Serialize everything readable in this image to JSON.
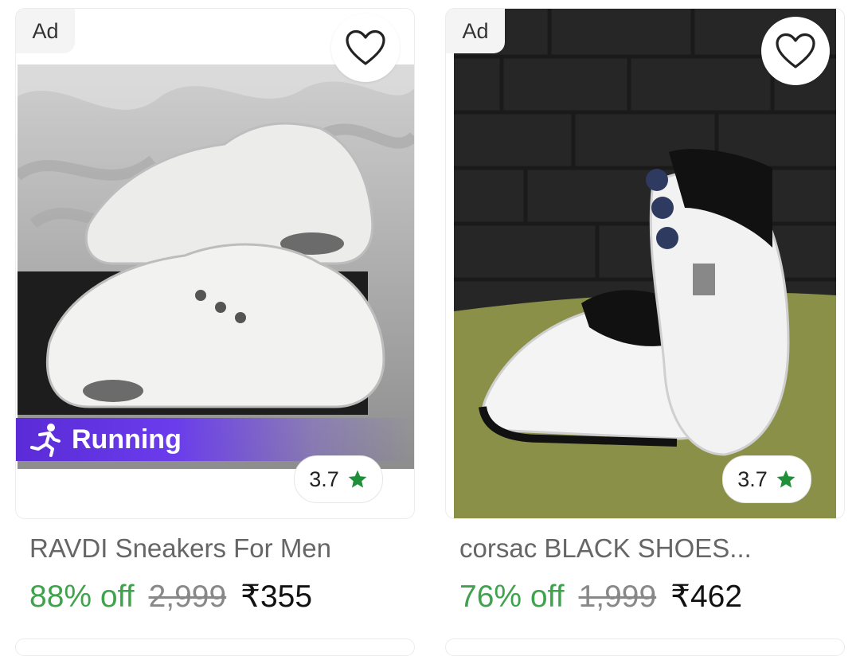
{
  "products": [
    {
      "ad_label": "Ad",
      "banner_label": "Running",
      "rating": "3.7",
      "title": "RAVDI Sneakers For Men",
      "discount": "88% off",
      "mrp": "2,999",
      "price": "₹355",
      "icons": {
        "wishlist": "heart-outline-icon",
        "rating": "star-icon",
        "banner": "runner-icon"
      }
    },
    {
      "ad_label": "Ad",
      "rating": "3.7",
      "title": "corsac BLACK SHOES...",
      "discount": "76% off",
      "mrp": "1,999",
      "price": "₹462",
      "icons": {
        "wishlist": "heart-outline-icon",
        "rating": "star-icon"
      }
    }
  ],
  "colors": {
    "discount_green": "#3fa34d",
    "star_green": "#1f8f3a",
    "running_banner_purple": "#5a2bd6",
    "ad_badge_bg": "#f4f4f4"
  }
}
